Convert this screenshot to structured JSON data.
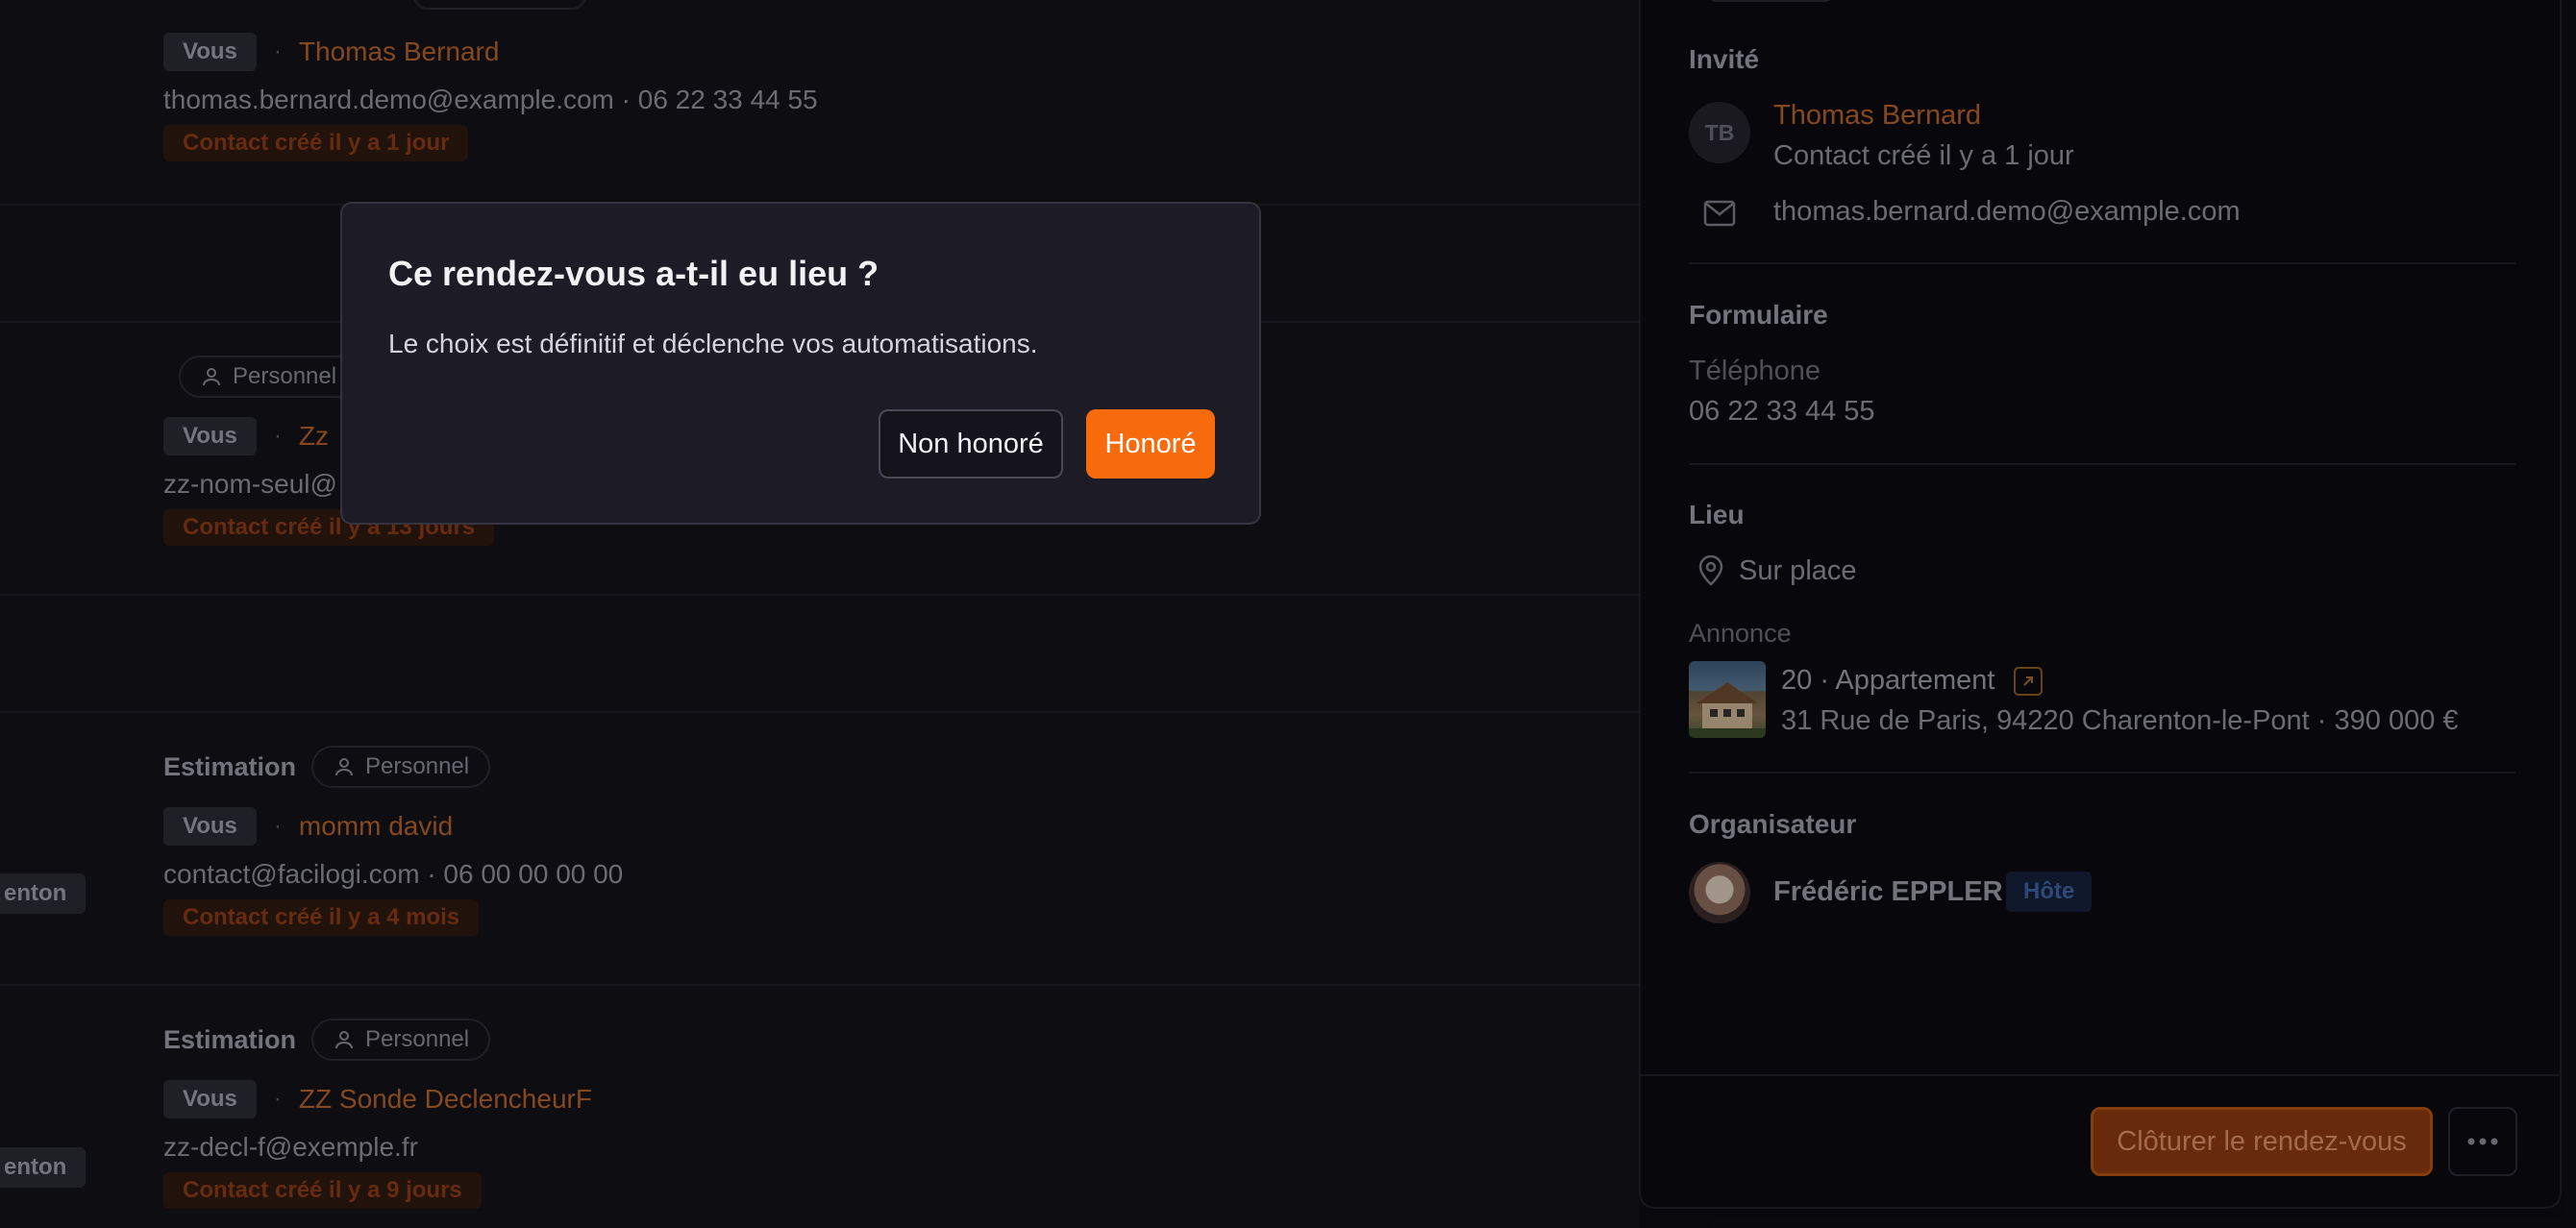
{
  "list": {
    "entries": [
      {
        "type": "",
        "owner": "",
        "you": "Vous",
        "name": "Thomas Bernard",
        "details": "thomas.bernard.demo@example.com · 06 22 33 44 55",
        "created": "Contact créé il y a 1 jour"
      },
      {
        "type": "",
        "owner": "Personnel",
        "you": "Vous",
        "name": "Zz",
        "details": "zz-nom-seul@",
        "created": "Contact créé il y a 13 jours"
      },
      {
        "type": "Estimation",
        "owner": "Personnel",
        "you": "Vous",
        "name": "momm david",
        "details": "contact@facilogi.com · 06 00 00 00 00",
        "created": "Contact créé il y a 4 mois",
        "location_chip": "enton"
      },
      {
        "type": "Estimation",
        "owner": "Personnel",
        "you": "Vous",
        "name": "ZZ Sonde DeclencheurF",
        "details": "zz-decl-f@exemple.fr",
        "created": "Contact créé il y a 9 jours",
        "location_chip": "enton"
      }
    ],
    "separator": "·"
  },
  "panel": {
    "invitee": {
      "title": "Invité",
      "initials": "TB",
      "name": "Thomas Bernard",
      "created": "Contact créé il y a 1 jour",
      "email": "thomas.bernard.demo@example.com"
    },
    "form": {
      "title": "Formulaire",
      "phone_label": "Téléphone",
      "phone": "06 22 33 44 55"
    },
    "place": {
      "title": "Lieu",
      "value": "Sur place",
      "listing_label": "Annonce",
      "listing_title": "20 · Appartement",
      "listing_address": "31 Rue de Paris, 94220 Charenton-le-Pont · 390 000 €"
    },
    "organizer": {
      "title": "Organisateur",
      "name": "Frédéric EPPLER",
      "badge": "Hôte"
    },
    "footer": {
      "close_label": "Clôturer le rendez-vous"
    }
  },
  "modal": {
    "title": "Ce rendez-vous a-t-il eu lieu ?",
    "description": "Le choix est définitif et déclenche vos automatisations.",
    "secondary_label": "Non honoré",
    "primary_label": "Honoré"
  },
  "colors": {
    "accent": "#f76b0d",
    "background": "#0d0d12",
    "modal": "#1c1b26"
  },
  "icons": [
    "person-icon",
    "mail-icon",
    "map-pin-icon",
    "external-link-icon",
    "more-horizontal-icon"
  ]
}
